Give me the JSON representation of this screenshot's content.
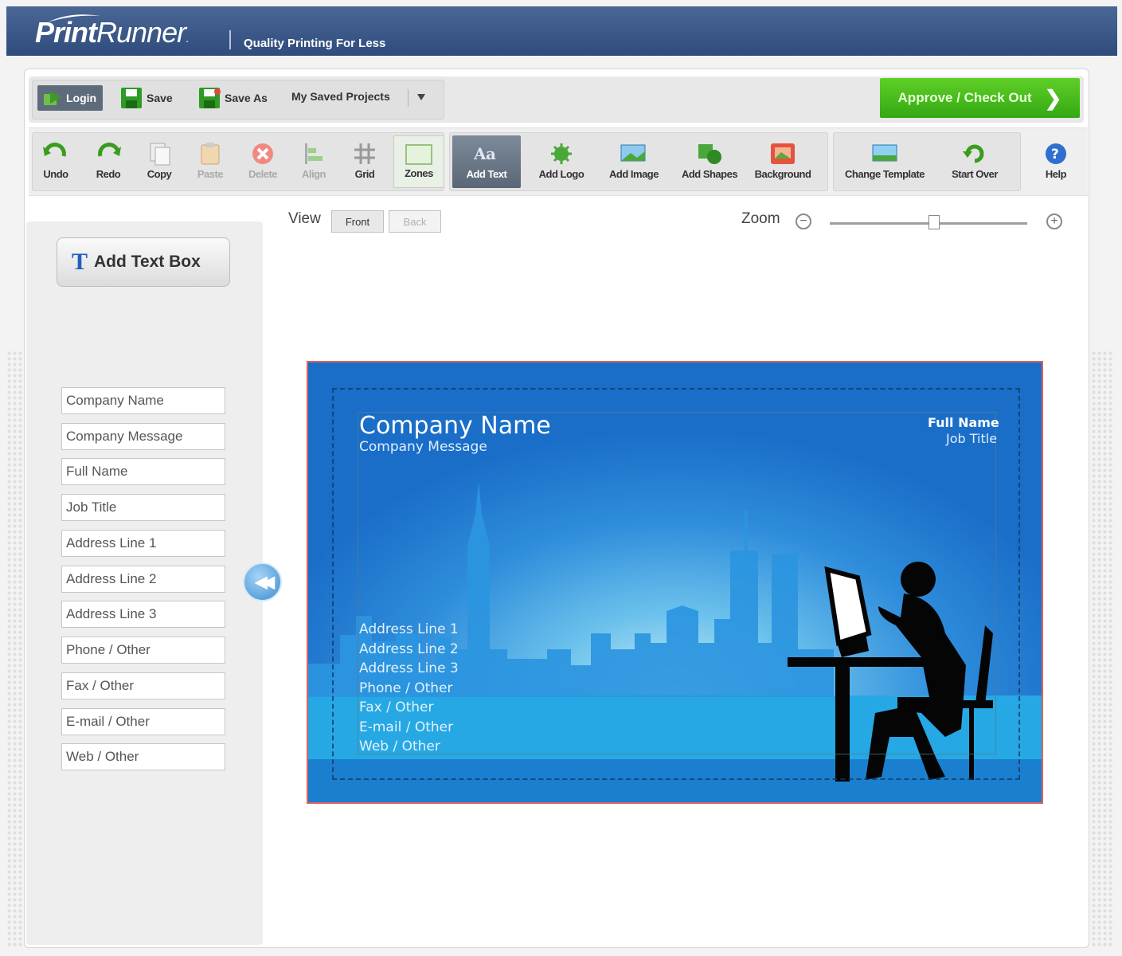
{
  "brand": {
    "logo_bold": "Print",
    "logo_rest": "Runner",
    "registered": ".",
    "tagline": "Quality Printing For Less"
  },
  "topbar": {
    "login": "Login",
    "save": "Save",
    "save_as": "Save As",
    "saved_projects": "My Saved Projects",
    "approve": "Approve / Check Out"
  },
  "toolbar": {
    "undo": "Undo",
    "redo": "Redo",
    "copy": "Copy",
    "paste": "Paste",
    "delete": "Delete",
    "align": "Align",
    "grid": "Grid",
    "zones": "Zones",
    "add_text": "Add Text",
    "add_text_glyph": "Aa",
    "add_logo": "Add Logo",
    "add_image": "Add Image",
    "add_shapes": "Add Shapes",
    "background": "Background",
    "change_template": "Change Template",
    "start_over": "Start Over",
    "help": "Help"
  },
  "left_panel": {
    "add_text_box": "Add Text Box",
    "fields": [
      "Company Name",
      "Company Message",
      "Full Name",
      "Job Title",
      "Address Line 1",
      "Address Line 2",
      "Address Line 3",
      "Phone / Other",
      "Fax / Other",
      "E-mail / Other",
      "Web / Other"
    ]
  },
  "view": {
    "label": "View",
    "front": "Front",
    "back": "Back"
  },
  "zoom": {
    "label": "Zoom",
    "minus": "−",
    "plus": "+",
    "level": 0.55
  },
  "card": {
    "company_name": "Company Name",
    "company_message": "Company Message",
    "full_name": "Full Name",
    "job_title": "Job Title",
    "address_lines": [
      "Address Line 1",
      "Address Line 2",
      "Address Line 3",
      "Phone / Other",
      "Fax / Other",
      "E-mail / Other",
      "Web / Other"
    ]
  },
  "colors": {
    "header": "#3b5a8a",
    "approve": "#45bb1b",
    "card_border": "#e0605c",
    "card_blue": "#1a6ec8"
  }
}
